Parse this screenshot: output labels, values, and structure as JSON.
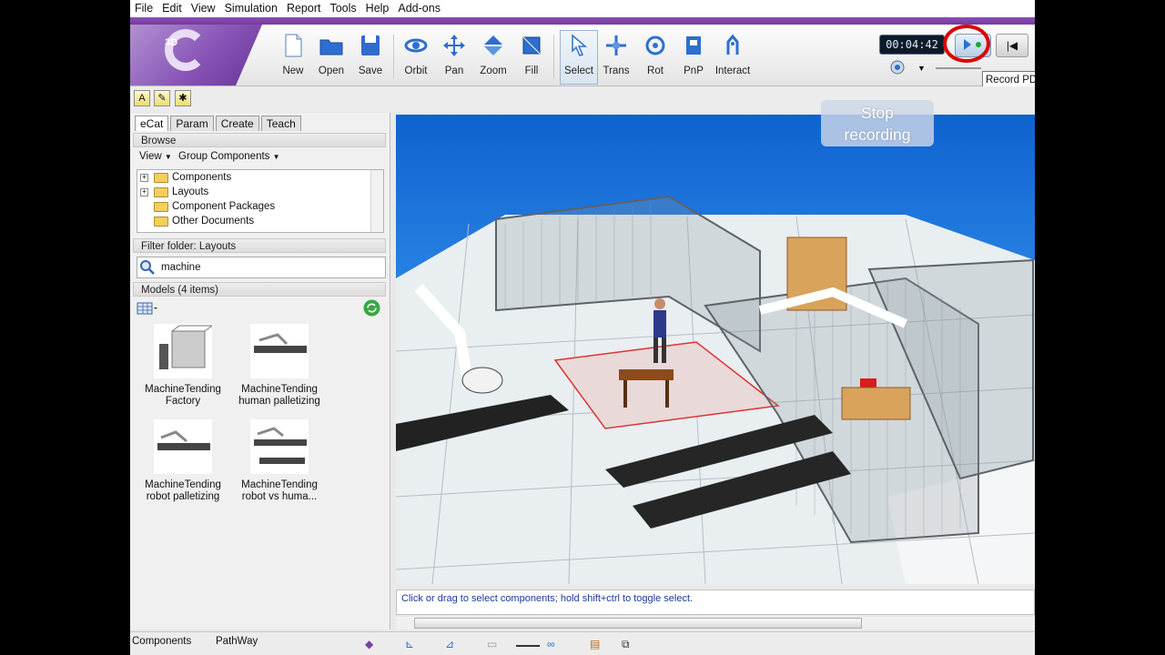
{
  "menu": [
    "File",
    "Edit",
    "View",
    "Simulation",
    "Report",
    "Tools",
    "Help",
    "Add-ons"
  ],
  "toolbar": {
    "buttons": [
      {
        "label": "New",
        "icon": "new-document-icon"
      },
      {
        "label": "Open",
        "icon": "open-folder-icon"
      },
      {
        "label": "Save",
        "icon": "save-disk-icon"
      },
      {
        "label": "Orbit",
        "icon": "orbit-icon"
      },
      {
        "label": "Pan",
        "icon": "pan-icon"
      },
      {
        "label": "Zoom",
        "icon": "zoom-icon"
      },
      {
        "label": "Fill",
        "icon": "fill-icon"
      },
      {
        "label": "Select",
        "icon": "select-cursor-icon"
      },
      {
        "label": "Trans",
        "icon": "translate-icon"
      },
      {
        "label": "Rot",
        "icon": "rotate-icon"
      },
      {
        "label": "PnP",
        "icon": "pnp-icon"
      },
      {
        "label": "Interact",
        "icon": "interact-icon"
      }
    ]
  },
  "recorder": {
    "time": "00:04:42",
    "tooltip": "Record PDF",
    "stop_label_1": "Stop",
    "stop_label_2": "recording"
  },
  "left": {
    "tabs": [
      "eCat",
      "Param",
      "Create",
      "Teach"
    ],
    "browse_title": "Browse",
    "view_label": "View",
    "group_label": "Group Components",
    "tree": [
      "Components",
      "Layouts",
      "Component Packages",
      "Other Documents"
    ],
    "filter_title": "Filter folder: Layouts",
    "search_value": "machine",
    "models_title": "Models (4 items)",
    "models": [
      {
        "line1": "MachineTending",
        "line2": "Factory"
      },
      {
        "line1": "MachineTending",
        "line2": "human palletizing"
      },
      {
        "line1": "MachineTending",
        "line2": "robot palletizing"
      },
      {
        "line1": "MachineTending",
        "line2": "robot vs huma..."
      }
    ]
  },
  "console": {
    "message": "Click or drag to select components; hold shift+ctrl to toggle select."
  },
  "status": {
    "tab1": "Components",
    "tab2": "PathWay"
  },
  "colors": {
    "accent_purple": "#7a3fa8",
    "viewport_blue": "#1a6fdb",
    "record_circle": "#dd0000"
  }
}
